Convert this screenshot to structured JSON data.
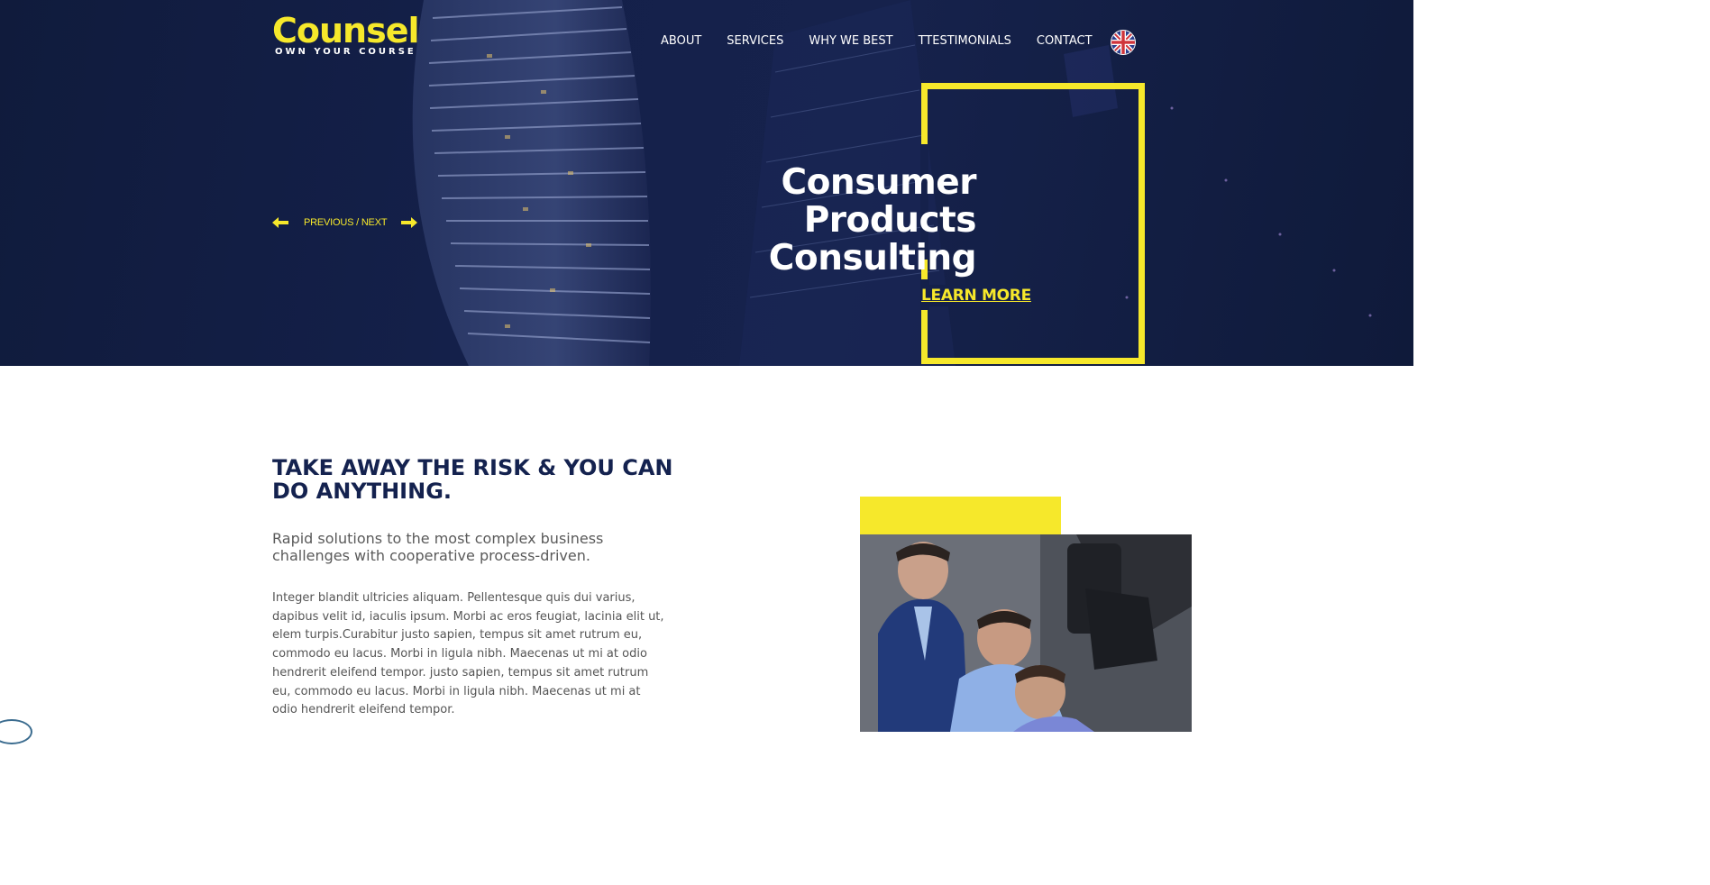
{
  "brand": {
    "name": "Counsel",
    "tagline": "OWN YOUR COURSE"
  },
  "nav": {
    "items": [
      {
        "label": "ABOUT"
      },
      {
        "label": "SERVICES"
      },
      {
        "label": "WHY WE BEST"
      },
      {
        "label": "TTESTIMONIALS"
      },
      {
        "label": "CONTACT"
      }
    ],
    "language_icon": "uk-flag-icon"
  },
  "hero": {
    "slider_nav_label": "PREVIOUS / NEXT",
    "headline_lines": [
      "Consumer",
      "Products",
      "Consulting"
    ],
    "cta_label": "LEARN MORE"
  },
  "intro": {
    "title": "TAKE AWAY THE RISK & YOU CAN DO ANYTHING.",
    "lead": "Rapid solutions to the most complex business challenges with cooperative process-driven.",
    "body": "Integer blandit ultricies aliquam. Pellentesque quis dui varius, dapibus velit id, iaculis ipsum. Morbi ac eros feugiat, lacinia elit ut, elem turpis.Curabitur justo sapien, tempus sit amet rutrum eu, commodo eu lacus. Morbi in ligula nibh. Maecenas ut mi at odio hendrerit eleifend tempor. justo sapien, tempus sit amet rutrum eu, commodo eu lacus. Morbi in ligula nibh. Maecenas ut mi at odio hendrerit eleifend tempor."
  },
  "colors": {
    "accent": "#f6e82b",
    "navy": "#14224f",
    "hero_bg": "#14204a"
  }
}
